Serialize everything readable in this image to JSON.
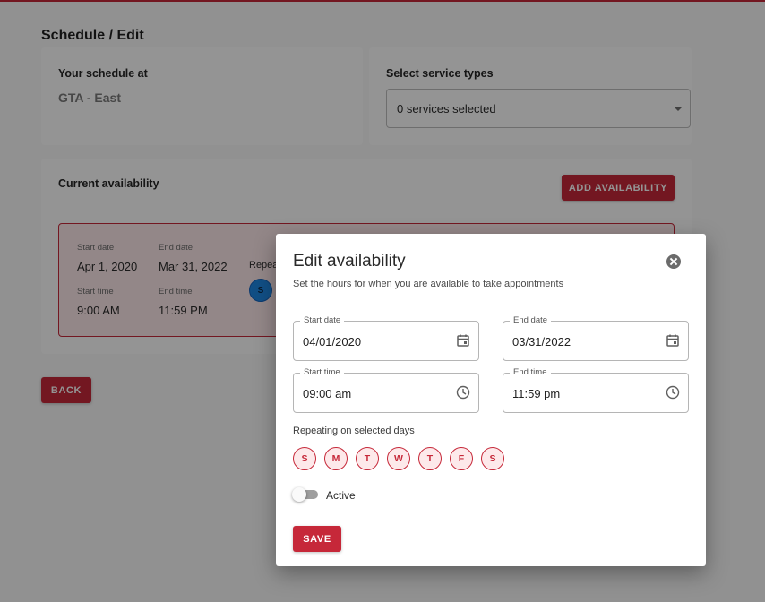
{
  "page": {
    "title": "Schedule / Edit"
  },
  "schedule_card": {
    "label": "Your schedule at",
    "location": "GTA - East"
  },
  "service_card": {
    "label": "Select service types",
    "select_value": "0 services selected"
  },
  "availability_card": {
    "label": "Current availability",
    "add_button": "ADD AVAILABILITY",
    "item": {
      "start_date_label": "Start date",
      "start_date": "Apr 1, 2020",
      "end_date_label": "End date",
      "end_date": "Mar 31, 2022",
      "start_time_label": "Start time",
      "start_time": "9:00 AM",
      "end_time_label": "End time",
      "end_time": "11:59 PM",
      "repeat_label": "Repea",
      "day_badge": "S"
    }
  },
  "back_button": "BACK",
  "modal": {
    "title": "Edit availability",
    "subtitle": "Set the hours for when you are available to take appointments",
    "start_date_label": "Start date",
    "start_date": "04/01/2020",
    "end_date_label": "End date",
    "end_date": "03/31/2022",
    "start_time_label": "Start time",
    "start_time": "09:00 am",
    "end_time_label": "End time",
    "end_time": "11:59 pm",
    "repeat_label": "Repeating on selected days",
    "days": [
      "S",
      "M",
      "T",
      "W",
      "T",
      "F",
      "S"
    ],
    "active_label": "Active",
    "active": false,
    "save_button": "SAVE"
  },
  "colors": {
    "accent": "#c62839",
    "accent_light": "#fde9ea",
    "badge_blue": "#1e88e5"
  },
  "icons": {
    "close": "close-circle-icon",
    "date": "calendar-icon",
    "time": "clock-icon",
    "select": "caret-down-icon"
  }
}
